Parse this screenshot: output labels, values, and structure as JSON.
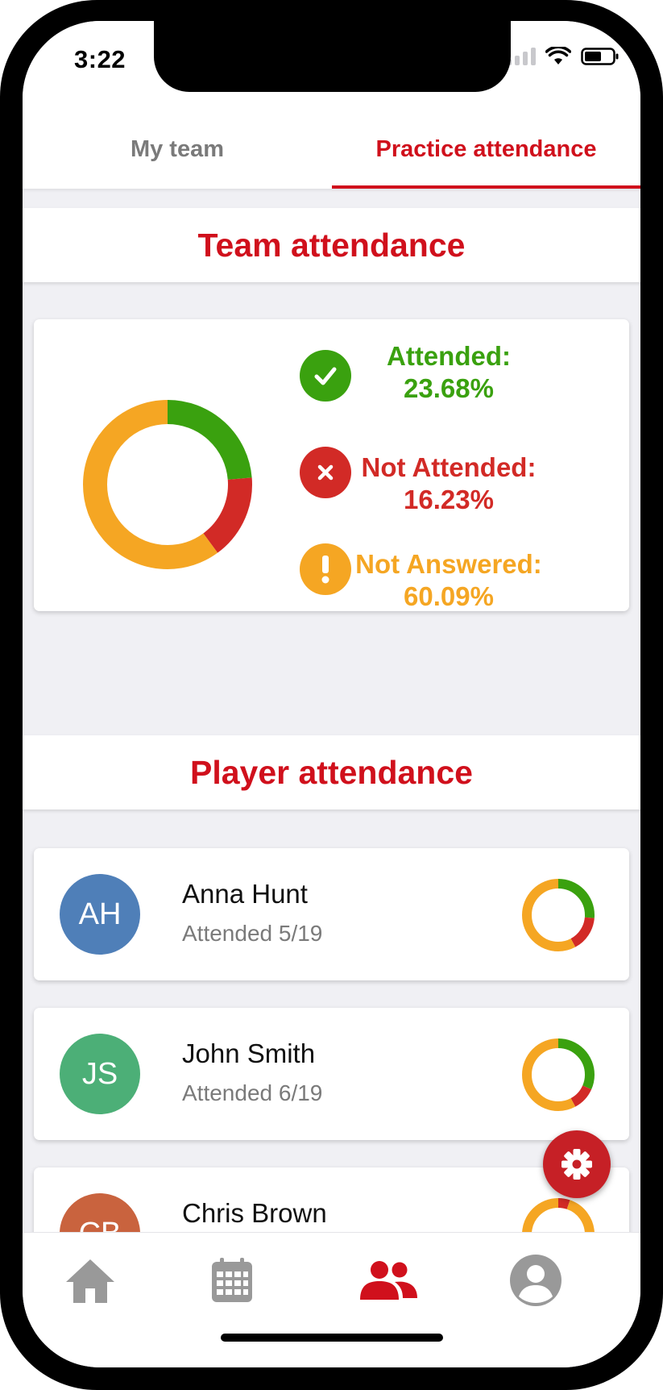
{
  "status_bar": {
    "time": "3:22"
  },
  "tabs": [
    {
      "label": "My team",
      "active": false
    },
    {
      "label": "Practice attendance",
      "active": true
    }
  ],
  "colors": {
    "accent": "#d0101c",
    "attended": "#3aa10f",
    "not_attended": "#d22a26",
    "not_answered": "#f5a623"
  },
  "team_attendance": {
    "title": "Team attendance",
    "legend": [
      {
        "label": "Attended:",
        "value": "23.68%",
        "icon": "check-icon"
      },
      {
        "label": "Not Attended:",
        "value": "16.23%",
        "icon": "cross-icon"
      },
      {
        "label": "Not Answered:",
        "value": "60.09%",
        "icon": "exclamation-icon"
      }
    ],
    "chart_data": {
      "type": "pie",
      "slices": [
        {
          "label": "Attended",
          "value": 23.68,
          "color": "#3aa10f"
        },
        {
          "label": "Not Attended",
          "value": 16.23,
          "color": "#d22a26"
        },
        {
          "label": "Not Answered",
          "value": 60.09,
          "color": "#f5a623"
        }
      ]
    }
  },
  "player_attendance": {
    "title": "Player attendance",
    "players": [
      {
        "initials": "AH",
        "name": "Anna Hunt",
        "subtitle": "Attended 5/19",
        "avatar_color": "#4f7fb8",
        "attended": 5,
        "not_attended": 3,
        "total": 19
      },
      {
        "initials": "JS",
        "name": "John Smith",
        "subtitle": "Attended 6/19",
        "avatar_color": "#4caf77",
        "attended": 6,
        "not_attended": 2,
        "total": 19
      },
      {
        "initials": "CB",
        "name": "Chris Brown",
        "subtitle": "",
        "avatar_color": "#c9633e",
        "attended": 0,
        "not_attended": 1,
        "total": 19
      }
    ]
  },
  "fab": {
    "icon": "gear-icon"
  },
  "bottom_nav": [
    {
      "icon": "home-icon",
      "active": false
    },
    {
      "icon": "calendar-icon",
      "active": false
    },
    {
      "icon": "team-icon",
      "active": true
    },
    {
      "icon": "profile-icon",
      "active": false
    }
  ]
}
